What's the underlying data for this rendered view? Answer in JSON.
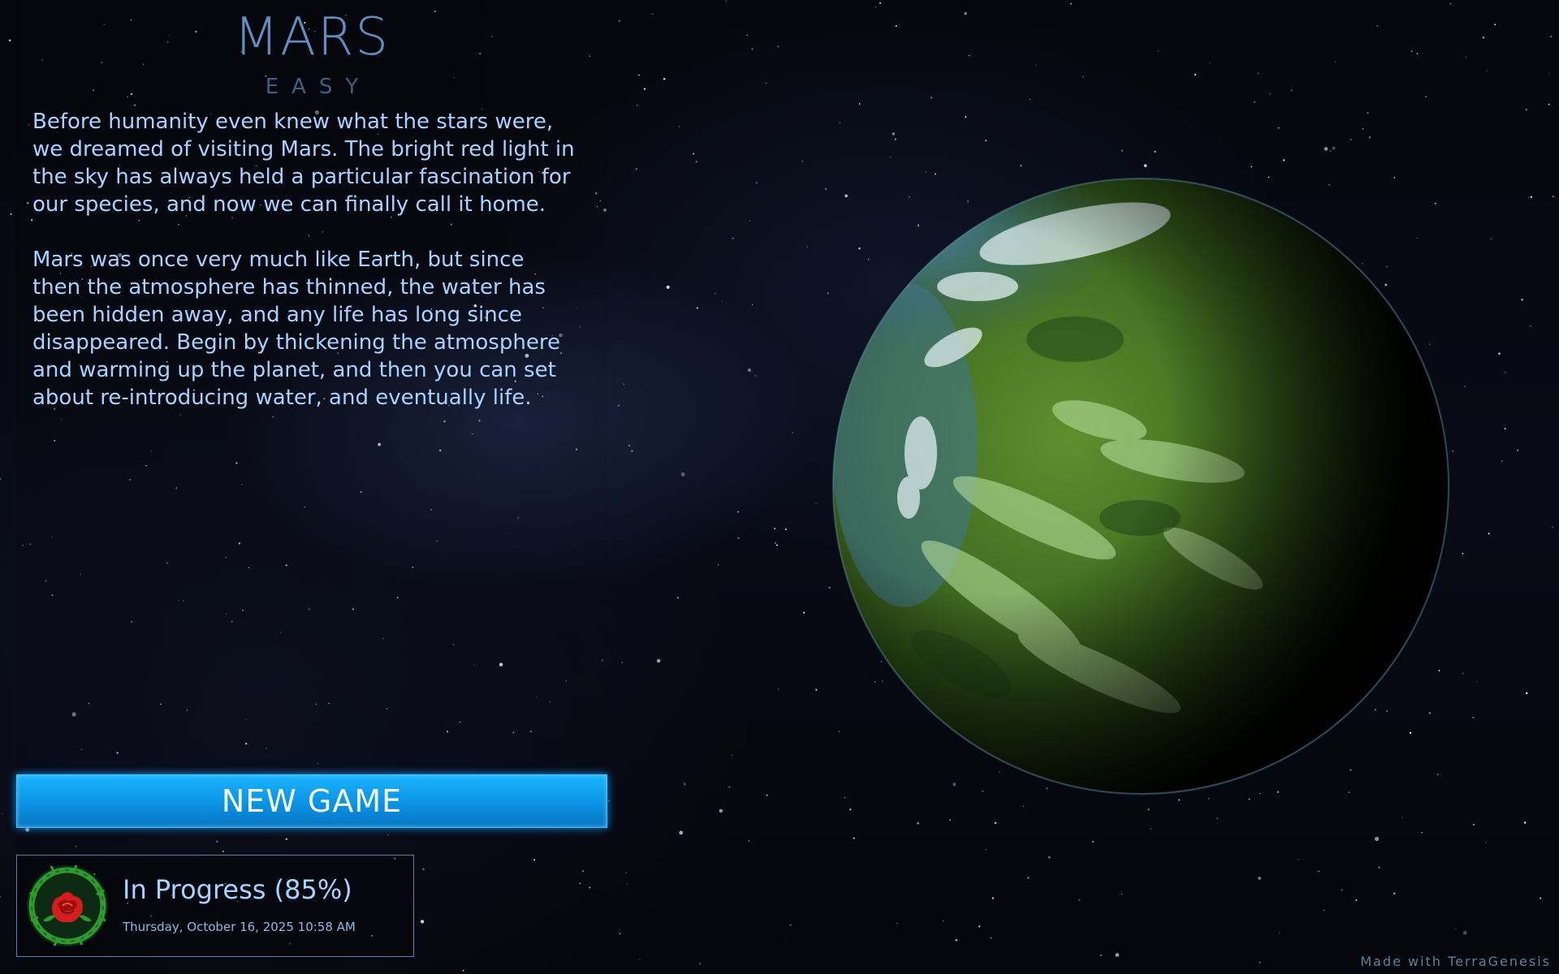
{
  "planet": {
    "name": "MARS",
    "difficulty": "EASY",
    "description": [
      "Before humanity even knew what the stars were, we dreamed of visiting Mars. The bright red light in the sky has always held a particular fascination for our species, and now we can finally call it home.",
      "Mars was once very much like Earth, but since then the atmosphere has thinned, the water has been hidden away, and any life has long since disappeared. Begin by thickening the atmosphere and warming up the planet, and then you can set about re-introducing water, and eventually life."
    ]
  },
  "actions": {
    "new_game_label": "NEW GAME"
  },
  "save_slot": {
    "emblem_icon": "rose-wreath-icon",
    "status": "In Progress (85%)",
    "progress_percent": 85,
    "date": "Thursday, October 16, 2025 10:58 AM"
  },
  "footer": {
    "credit": "Made with TerraGenesis"
  },
  "colors": {
    "accent": "#0a9cf0",
    "text": "#a8d2ff",
    "title": "#5f8fc2"
  }
}
